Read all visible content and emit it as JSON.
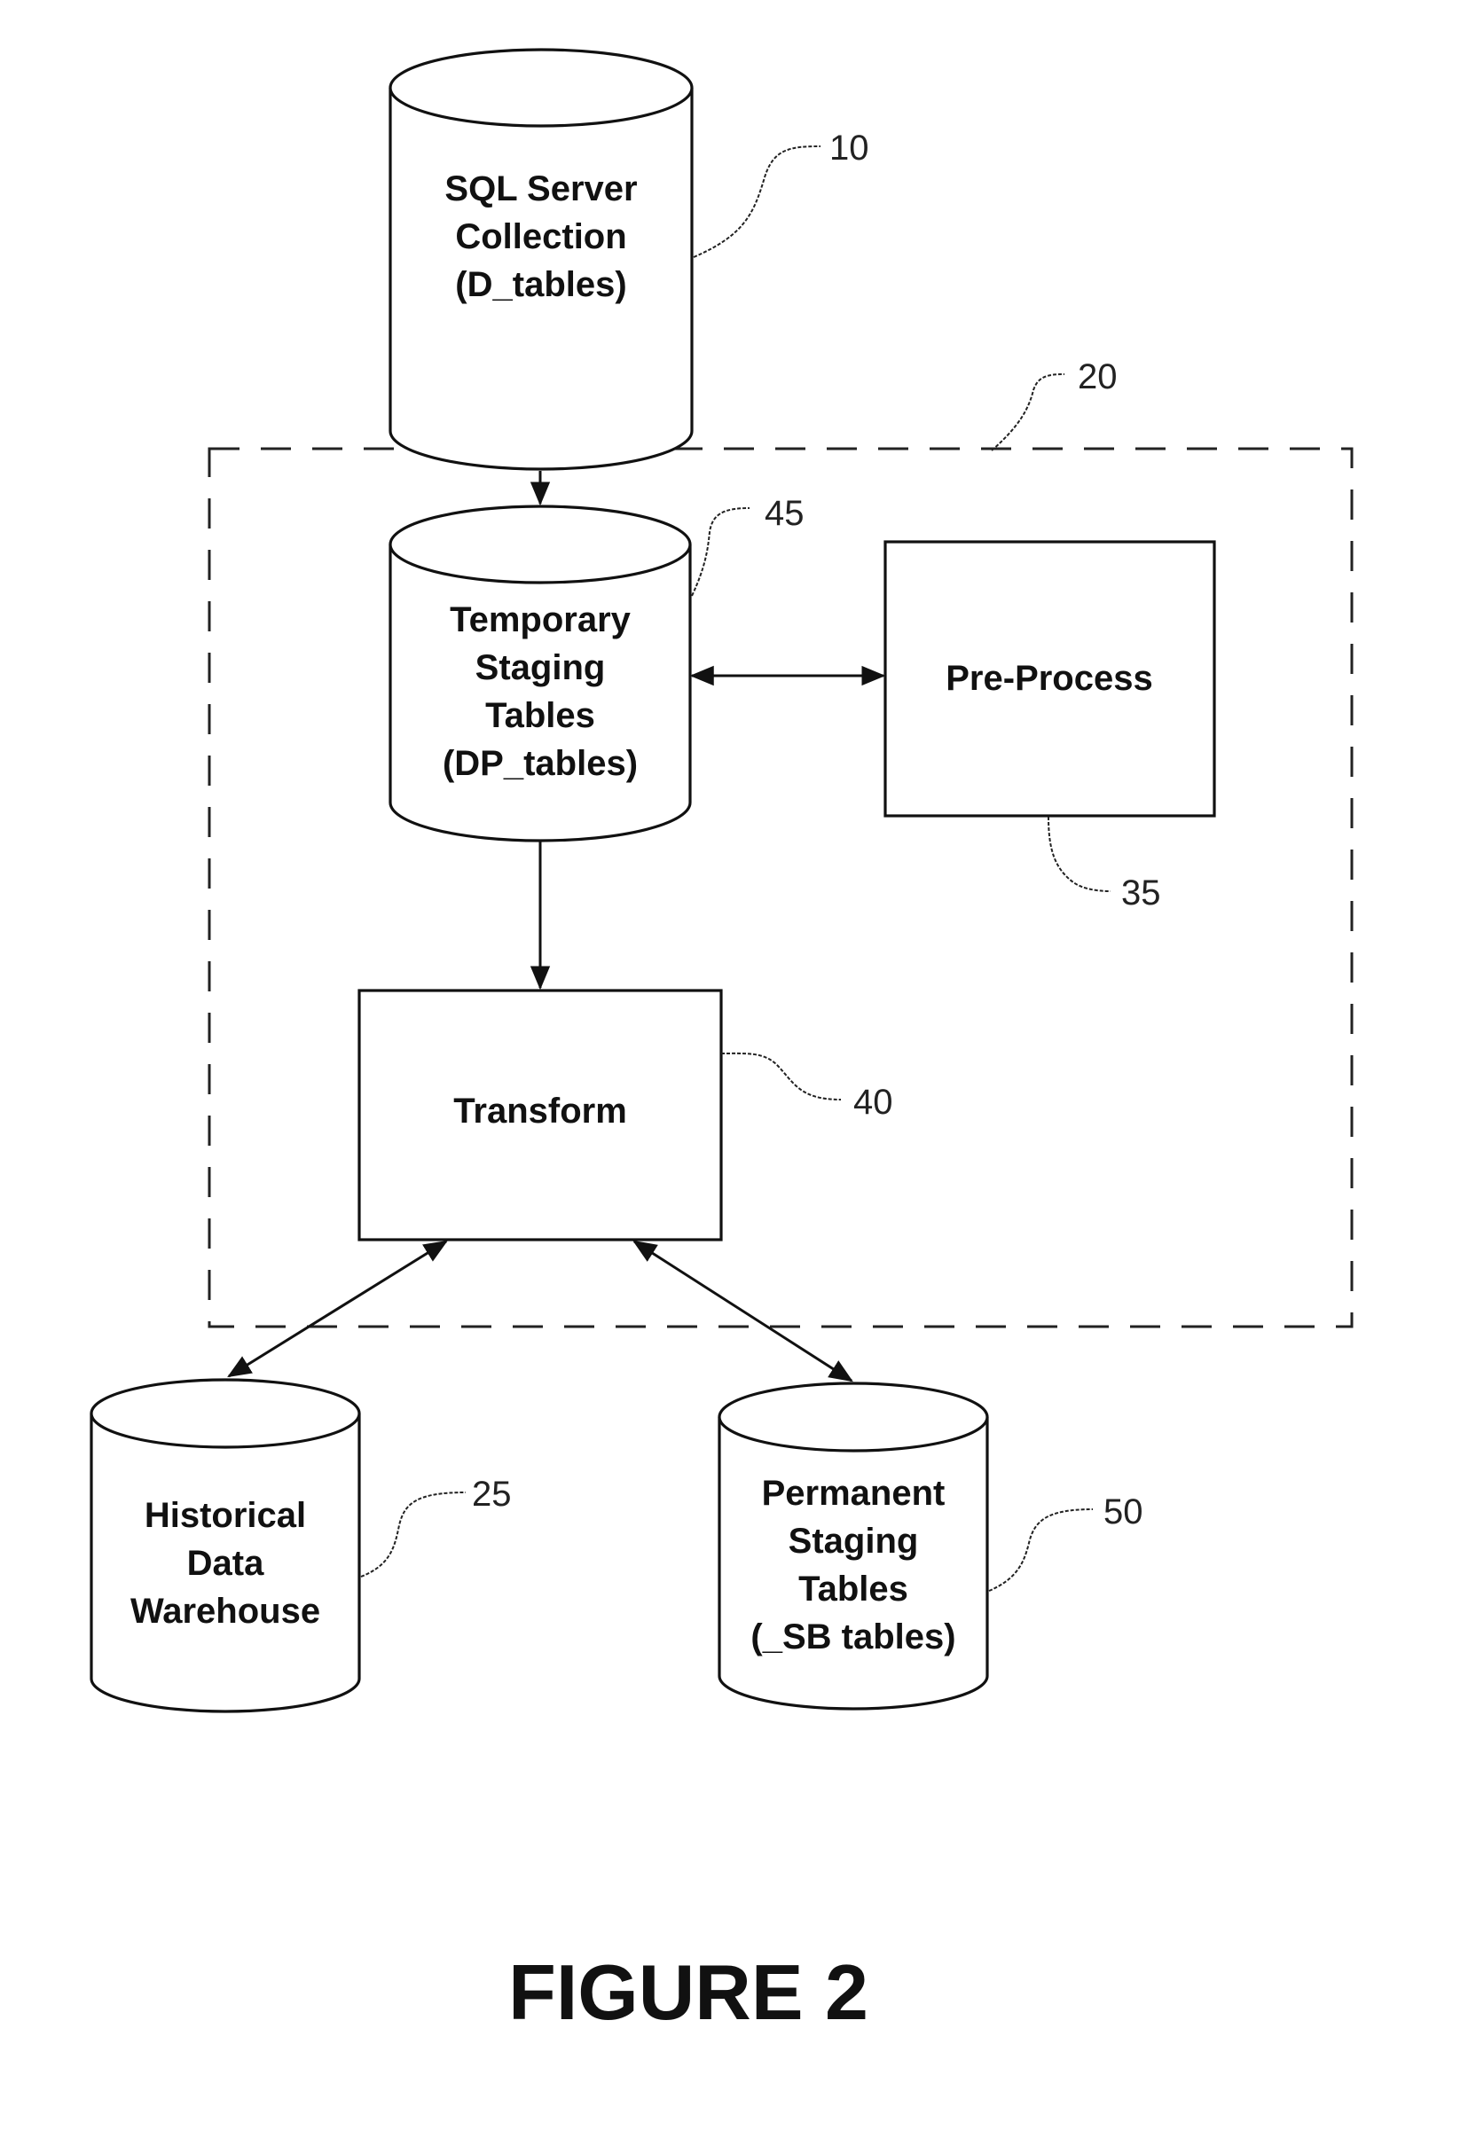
{
  "figure": {
    "caption": "FIGURE 2"
  },
  "nodes": [
    {
      "id": "sql-server-collection",
      "shape": "cylinder",
      "ref": "10",
      "lines": [
        "SQL Server",
        "Collection",
        "(D_tables)"
      ]
    },
    {
      "id": "temporary-staging-tables",
      "shape": "cylinder",
      "ref": "45",
      "lines": [
        "Temporary",
        "Staging",
        "Tables",
        "(DP_tables)"
      ]
    },
    {
      "id": "pre-process",
      "shape": "box",
      "ref": "35",
      "lines": [
        "Pre-Process"
      ]
    },
    {
      "id": "transform",
      "shape": "box",
      "ref": "40",
      "lines": [
        "Transform"
      ]
    },
    {
      "id": "historical-data-warehouse",
      "shape": "cylinder",
      "ref": "25",
      "lines": [
        "Historical",
        "Data",
        "Warehouse"
      ]
    },
    {
      "id": "permanent-staging-tables",
      "shape": "cylinder",
      "ref": "50",
      "lines": [
        "Permanent",
        "Staging",
        "Tables",
        "(_SB tables)"
      ]
    }
  ],
  "group": {
    "id": "processing-group",
    "ref": "20",
    "style": "dashed"
  },
  "edges": [
    {
      "from": "sql-server-collection",
      "to": "temporary-staging-tables",
      "direction": "forward"
    },
    {
      "from": "temporary-staging-tables",
      "to": "pre-process",
      "direction": "both"
    },
    {
      "from": "temporary-staging-tables",
      "to": "transform",
      "direction": "forward"
    },
    {
      "from": "transform",
      "to": "historical-data-warehouse",
      "direction": "both"
    },
    {
      "from": "transform",
      "to": "permanent-staging-tables",
      "direction": "both"
    }
  ]
}
